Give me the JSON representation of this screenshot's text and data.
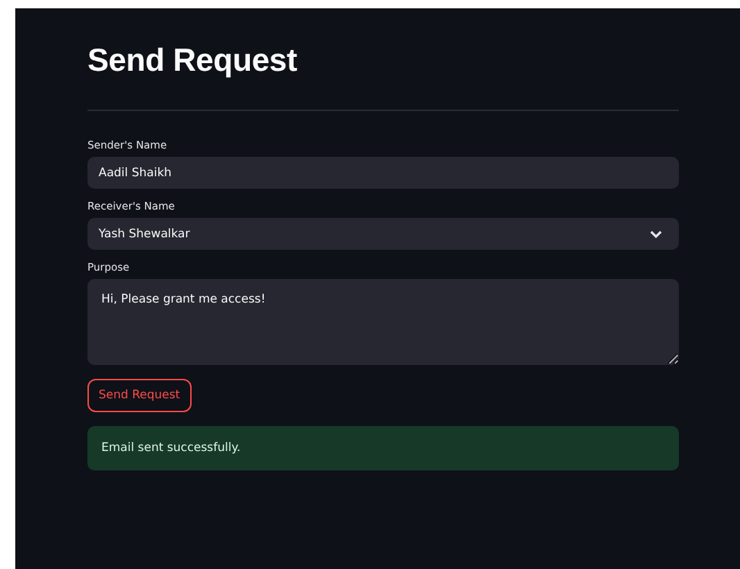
{
  "title": "Send Request",
  "fields": [
    {
      "kind": "text",
      "label": "Sender's Name",
      "value": "Aadil Shaikh"
    },
    {
      "kind": "select",
      "label": "Receiver's Name",
      "value": "Yash Shewalkar"
    },
    {
      "kind": "textarea",
      "label": "Purpose",
      "value": "Hi, Please grant me access!"
    }
  ],
  "button": {
    "label": "Send Request"
  },
  "alert": {
    "kind": "success",
    "text": "Email sent successfully."
  }
}
